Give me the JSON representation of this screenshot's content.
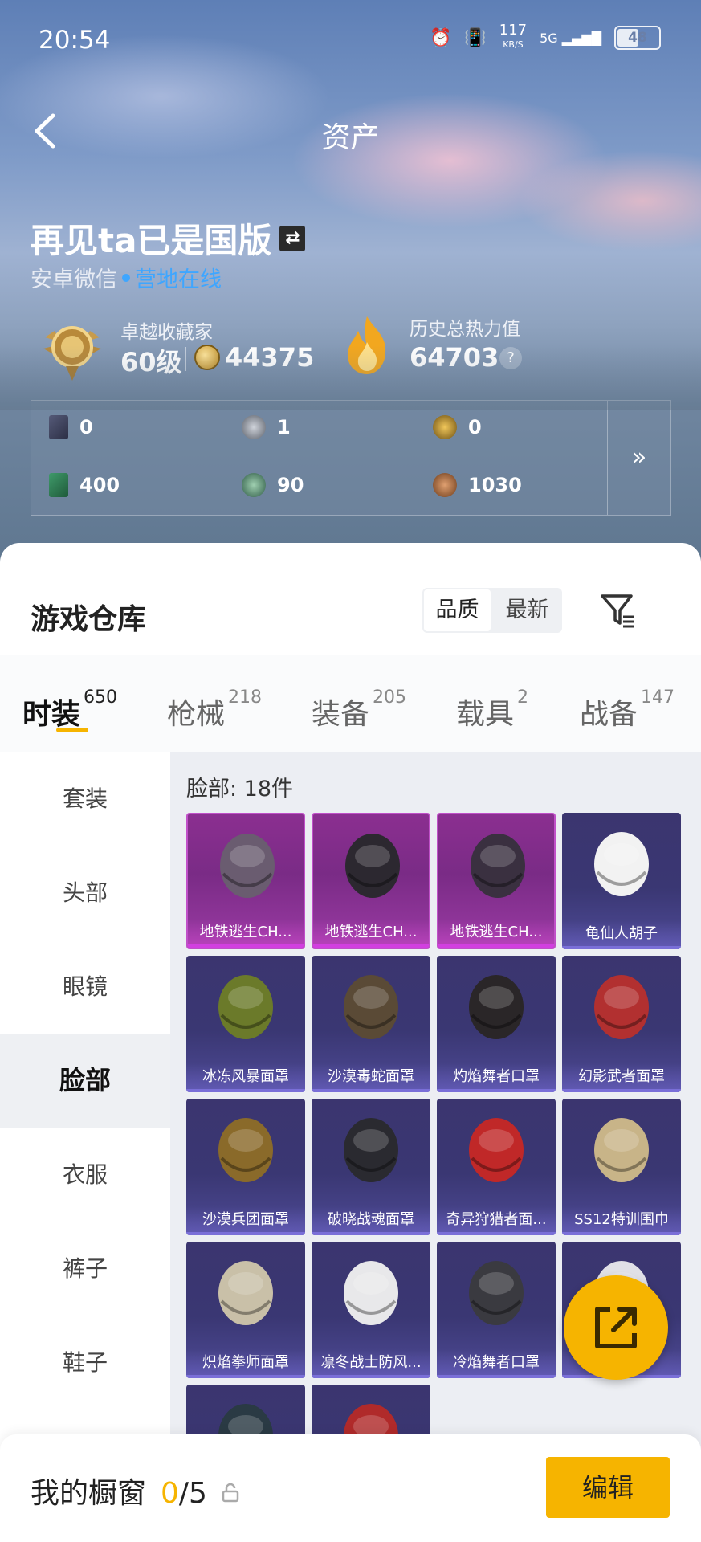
{
  "status": {
    "time": "20:54",
    "net_speed": "117",
    "net_unit": "KB/S",
    "signal": "5G",
    "battery": "48"
  },
  "nav": {
    "title": "资产"
  },
  "player": {
    "name": "再见ta已是国版",
    "platform": "安卓微信",
    "online_status": "营地在线"
  },
  "stats": {
    "collector_label": "卓越收藏家",
    "level": "60级",
    "coins": "44375",
    "heat_label": "历史总热力值",
    "heat_value": "64703",
    "help": "?"
  },
  "currencies": [
    {
      "value": "0",
      "icon": "card-icon"
    },
    {
      "value": "1",
      "icon": "silver-token-icon"
    },
    {
      "value": "0",
      "icon": "gold-token-icon"
    },
    {
      "value": "400",
      "icon": "green-card-icon"
    },
    {
      "value": "90",
      "icon": "green-token-icon"
    },
    {
      "value": "1030",
      "icon": "bronze-token-icon"
    }
  ],
  "more": "»",
  "warehouse": {
    "title": "游戏仓库",
    "sort_options": [
      "品质",
      "最新"
    ],
    "active_sort": 0
  },
  "categories": [
    {
      "label": "时装",
      "count": "650"
    },
    {
      "label": "枪械",
      "count": "218"
    },
    {
      "label": "装备",
      "count": "205"
    },
    {
      "label": "载具",
      "count": "2"
    },
    {
      "label": "战备",
      "count": "147"
    }
  ],
  "sidebar": [
    "套装",
    "头部",
    "眼镜",
    "脸部",
    "衣服",
    "裤子",
    "鞋子"
  ],
  "grid": {
    "count_label": "脸部: 18件",
    "items": [
      {
        "label": "地铁逃生CH...",
        "rarity": "purple",
        "icon": "gas-mask-icon"
      },
      {
        "label": "地铁逃生CH...",
        "rarity": "purple",
        "icon": "face-mask-icon"
      },
      {
        "label": "地铁逃生CH...",
        "rarity": "purple",
        "icon": "spiked-mask-icon"
      },
      {
        "label": "龟仙人胡子",
        "rarity": "blue",
        "icon": "beard-icon"
      },
      {
        "label": "冰冻风暴面罩",
        "rarity": "blue",
        "icon": "scarf-mask-icon"
      },
      {
        "label": "沙漠毒蛇面罩",
        "rarity": "blue",
        "icon": "goggle-mask-icon"
      },
      {
        "label": "灼焰舞者口罩",
        "rarity": "blue",
        "icon": "flame-mask-icon"
      },
      {
        "label": "幻影武者面罩",
        "rarity": "blue",
        "icon": "red-helmet-icon"
      },
      {
        "label": "沙漠兵团面罩",
        "rarity": "blue",
        "icon": "gold-mask-icon"
      },
      {
        "label": "破晓战魂面罩",
        "rarity": "blue",
        "icon": "dark-mask-icon"
      },
      {
        "label": "奇异狩猎者面...",
        "rarity": "blue",
        "icon": "spider-mask-icon"
      },
      {
        "label": "SS12特训围巾",
        "rarity": "blue",
        "icon": "shemagh-icon"
      },
      {
        "label": "炽焰拳师面罩",
        "rarity": "blue",
        "icon": "oni-mask-icon"
      },
      {
        "label": "凛冬战士防风...",
        "rarity": "blue",
        "icon": "balaclava-icon"
      },
      {
        "label": "冷焰舞者口罩",
        "rarity": "blue",
        "icon": "white-flame-mask-icon"
      },
      {
        "label": "具",
        "rarity": "blue",
        "icon": "skull-mask-icon"
      },
      {
        "label": "",
        "rarity": "blue",
        "icon": "cat-mask-icon"
      },
      {
        "label": "",
        "rarity": "blue",
        "icon": "red-item-icon"
      }
    ]
  },
  "showcase": {
    "label": "我的橱窗",
    "current": "0",
    "total": "/5",
    "edit": "编辑"
  },
  "colors": {
    "accent": "#f6b400",
    "online": "#3ea6ff",
    "purple_card": "#8b2f90",
    "blue_card": "#3b356f"
  }
}
